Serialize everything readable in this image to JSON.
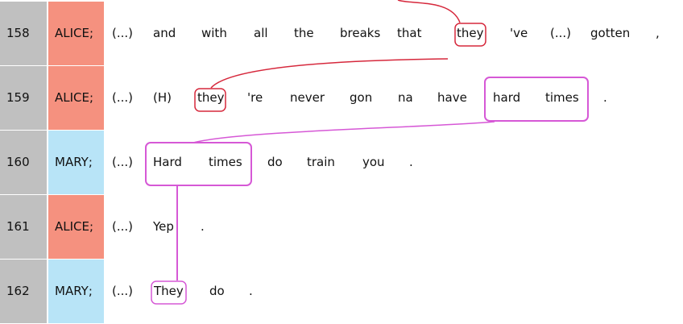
{
  "colors": {
    "alice": "#f5917f",
    "mary": "#b8e4f7",
    "line_num_bg": "#c0c0c0",
    "chain_red": "#d6283c",
    "chain_magenta": "#d658d6"
  },
  "rows": [
    {
      "num": "158",
      "speaker": "ALICE;",
      "speaker_key": "alice",
      "tokens": [
        "(...)",
        "and",
        "with",
        "all",
        "the",
        "breaks",
        "that",
        "they",
        "'ve",
        "(...)",
        "gotten",
        ","
      ]
    },
    {
      "num": "159",
      "speaker": "ALICE;",
      "speaker_key": "alice",
      "tokens": [
        "(...)",
        "(H)",
        "they",
        "'re",
        "never",
        "gon",
        "na",
        "have",
        "hard",
        "times",
        "."
      ]
    },
    {
      "num": "160",
      "speaker": "MARY;",
      "speaker_key": "mary",
      "tokens": [
        "(...)",
        "Hard",
        "times",
        "do",
        "train",
        "you",
        "."
      ]
    },
    {
      "num": "161",
      "speaker": "ALICE;",
      "speaker_key": "alice",
      "tokens": [
        "(...)",
        "Yep",
        "."
      ]
    },
    {
      "num": "162",
      "speaker": "MARY;",
      "speaker_key": "mary",
      "tokens": [
        "(...)",
        "They",
        "do",
        "."
      ]
    }
  ]
}
